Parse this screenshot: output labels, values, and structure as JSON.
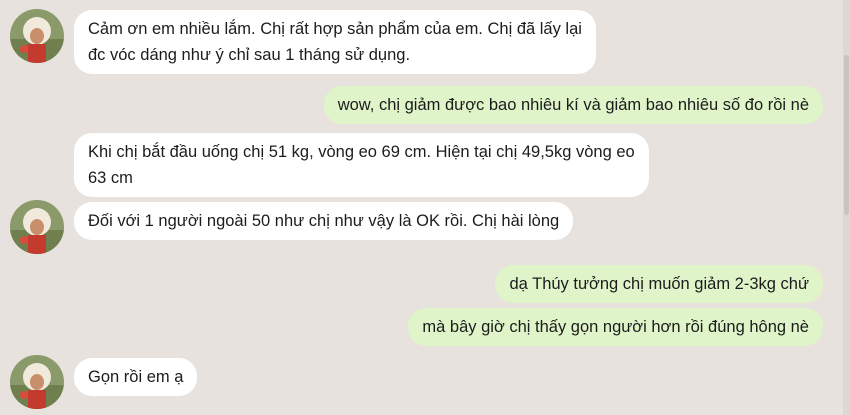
{
  "messages": [
    {
      "text": "Cảm ơn em nhiều lắm. Chị rất hợp sản phẩm của em. Chị đã lấy lại\nđc vóc dáng như ý chỉ sau 1 tháng sử dụng."
    },
    {
      "text": "wow, chị giảm được bao nhiêu kí và giảm bao nhiêu số đo rồi nè"
    },
    {
      "text": "Khi chị bắt đầu uống chị 51 kg, vòng eo 69 cm. Hiện tại chị 49,5kg vòng eo\n63 cm"
    },
    {
      "text": "Đối với 1 người ngoài 50 như chị như vậy là OK rồi. Chị hài lòng"
    },
    {
      "text": "dạ Thúy tưởng chị muốn giảm 2-3kg chứ"
    },
    {
      "text": "mà bây giờ chị thấy gọn người hơn rồi đúng hông nè"
    },
    {
      "text": "Gọn rồi em ạ"
    }
  ],
  "colors": {
    "background": "#e7e2dd",
    "incoming_bubble": "#ffffff",
    "outgoing_bubble": "#dff5c9"
  }
}
